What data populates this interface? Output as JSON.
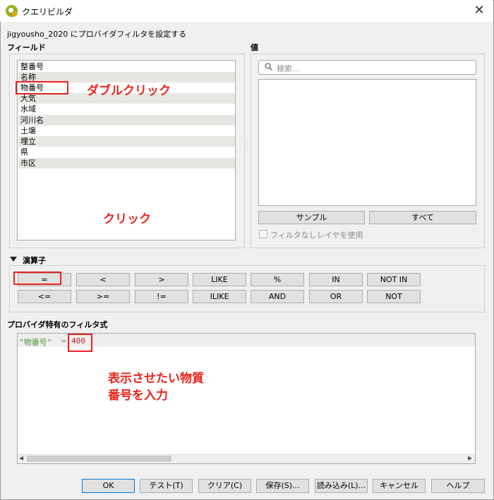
{
  "window": {
    "title": "クエリビルダ",
    "close_glyph": "✕"
  },
  "description": "jigyousho_2020 にプロバイダフィルタを設定する",
  "fields": {
    "label": "フィールド",
    "items": [
      "整番号",
      "名称",
      "物番号",
      "大気",
      "水域",
      "河川名",
      "土壌",
      "埋立",
      "県",
      "市区"
    ]
  },
  "values": {
    "label": "値",
    "search_placeholder": "検索...",
    "sample_button": "サンプル",
    "all_button": "すべて",
    "unfiltered_checkbox_label": "フィルタなしレイヤを使用",
    "unfiltered_checked": false
  },
  "operators": {
    "label": "演算子",
    "row1": [
      "=",
      "<",
      ">",
      "LIKE",
      "%",
      "IN",
      "NOT IN"
    ],
    "row2": [
      "<=",
      ">=",
      "!=",
      "ILIKE",
      "AND",
      "OR",
      "NOT"
    ]
  },
  "expression": {
    "label": "プロバイダ特有のフィルタ式",
    "field": "\"物番号\"",
    "operator": "=",
    "value": "400"
  },
  "footer_buttons": {
    "ok": "OK",
    "test": "テスト(T)",
    "clear": "クリア(C)",
    "save": "保存(S)...",
    "load": "読み込み(L)...",
    "cancel": "キャンセル",
    "help": "ヘルプ"
  },
  "annotations": {
    "double_click": "ダブルクリック",
    "click": "クリック",
    "enter_number_line1": "表示させたい物質",
    "enter_number_line2": "番号を入力",
    "highlight_color": "#e8231d"
  }
}
